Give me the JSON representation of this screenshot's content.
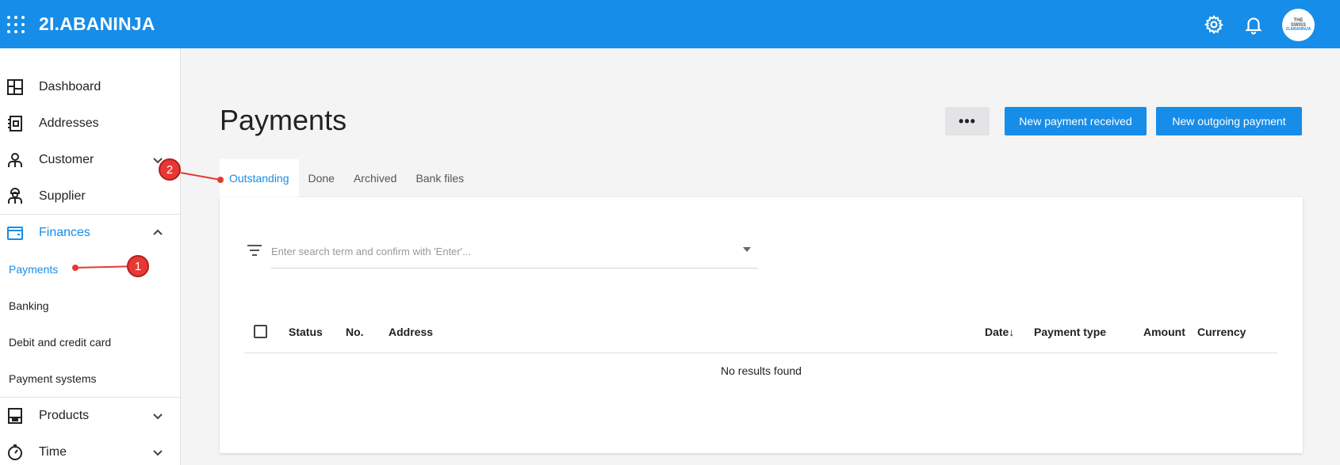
{
  "app": {
    "brand": "2I.ABANINJA",
    "avatar_line1": "THE",
    "avatar_line2": "SWISS",
    "avatar_line3": "2I.ABANINJA"
  },
  "sidebar": {
    "items": [
      {
        "label": "Dashboard",
        "icon": "dashboard-icon"
      },
      {
        "label": "Addresses",
        "icon": "address-book-icon"
      },
      {
        "label": "Customer",
        "icon": "customer-icon"
      },
      {
        "label": "Supplier",
        "icon": "supplier-icon"
      },
      {
        "label": "Finances",
        "icon": "wallet-icon"
      }
    ],
    "finances_sub": [
      {
        "label": "Payments"
      },
      {
        "label": "Banking"
      },
      {
        "label": "Debit and credit card"
      },
      {
        "label": "Payment systems"
      }
    ],
    "lower_items": [
      {
        "label": "Products",
        "icon": "box-icon"
      },
      {
        "label": "Time",
        "icon": "stopwatch-icon"
      }
    ]
  },
  "main": {
    "title": "Payments",
    "more_label": "•••",
    "new_received_label": "New payment received",
    "new_outgoing_label": "New outgoing payment",
    "tabs": [
      {
        "label": "Outstanding"
      },
      {
        "label": "Done"
      },
      {
        "label": "Archived"
      },
      {
        "label": "Bank files"
      }
    ],
    "search_placeholder": "Enter search term and confirm with 'Enter'...",
    "columns": {
      "status": "Status",
      "no": "No.",
      "address": "Address",
      "date": "Date",
      "date_sort": "↓",
      "payment_type": "Payment type",
      "amount": "Amount",
      "currency": "Currency"
    },
    "empty_message": "No results found"
  },
  "annotations": {
    "badge1": "1",
    "badge2": "2"
  },
  "colors": {
    "accent": "#168de8",
    "annotation": "#e53935"
  }
}
